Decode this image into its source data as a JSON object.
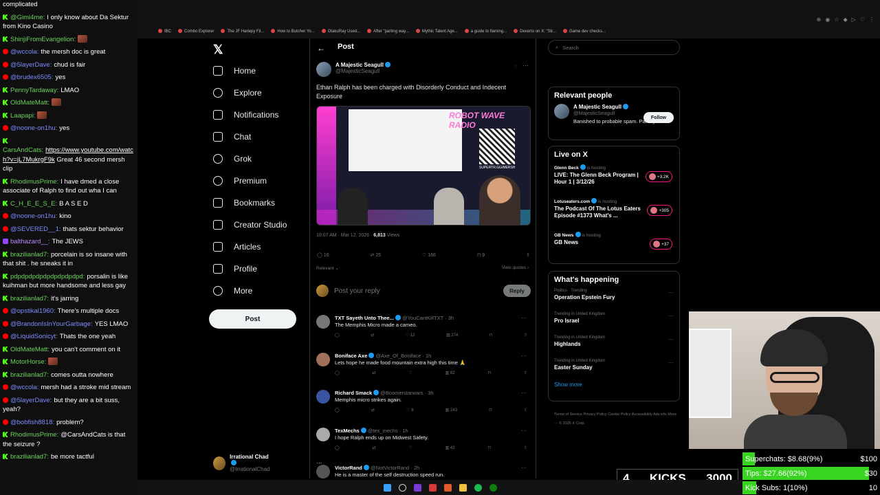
{
  "chat": [
    {
      "platform": "none",
      "user": "",
      "text": "complicated"
    },
    {
      "platform": "kick",
      "user": "@Gimi4me:",
      "text": "I only know about Da Sektur from Kino Casino"
    },
    {
      "platform": "kick",
      "user": "ShinjiFromEvangelion:",
      "text": ""
    },
    {
      "platform": "yt",
      "user": "@wccola:",
      "text": "the mersh doc is great"
    },
    {
      "platform": "yt",
      "user": "@5layerDave:",
      "text": "chud is fair"
    },
    {
      "platform": "yt",
      "user": "@brudex6505:",
      "text": "yes"
    },
    {
      "platform": "kick",
      "user": "PennyTardaway:",
      "text": "LMAO"
    },
    {
      "platform": "kick",
      "user": "OldMateMatt:",
      "text": ""
    },
    {
      "platform": "kick",
      "user": "Laapapi:",
      "text": ""
    },
    {
      "platform": "yt",
      "user": "@noone-on1hu:",
      "text": "yes"
    },
    {
      "platform": "kick",
      "user": "CarsAndCats:",
      "text": "Great 46 second mersh clip",
      "link": "https://www.youtube.com/watch?v=jL7MukrgF9k"
    },
    {
      "platform": "kick",
      "user": "RhodimusPrime:",
      "text": "I have dmed a close associate of Ralph to find out wha I can"
    },
    {
      "platform": "kick",
      "user": "C_H_E_E_S_E:",
      "text": "B A S E D"
    },
    {
      "platform": "yt",
      "user": "@noone-on1hu:",
      "text": "kino"
    },
    {
      "platform": "yt",
      "user": "@SEVERED__1:",
      "text": "thats sektur behavior"
    },
    {
      "platform": "twitch",
      "user": "balthazard__:",
      "text": "The JEWS"
    },
    {
      "platform": "kick",
      "user": "brazilianlad7:",
      "text": "porcelain is so insane with that shit . he sneaks it in"
    },
    {
      "platform": "kick",
      "user": "pdpdpdpdpdpdpdpdpdpd:",
      "text": "porsalin is like kuihman but more handsome and less gay"
    },
    {
      "platform": "kick",
      "user": "brazilianlad7:",
      "text": "it's jarring"
    },
    {
      "platform": "yt",
      "user": "@opstikal1960:",
      "text": "There's multiple docs"
    },
    {
      "platform": "yt",
      "user": "@BrandonIsInYourGarbage:",
      "text": "YES LMAO"
    },
    {
      "platform": "yt",
      "user": "@LiquidSonicyt:",
      "text": "Thats the one yeah"
    },
    {
      "platform": "kick",
      "user": "OldMateMatt:",
      "text": "you can't comment on it"
    },
    {
      "platform": "kick",
      "user": "MotorHorse:",
      "text": ""
    },
    {
      "platform": "kick",
      "user": "brazilianlad7:",
      "text": "comes outta nowhere"
    },
    {
      "platform": "yt",
      "user": "@wccola:",
      "text": "mersh had a stroke mid stream"
    },
    {
      "platform": "yt",
      "user": "@5layerDave:",
      "text": "but they are a bit suss, yeah?"
    },
    {
      "platform": "yt",
      "user": "@bobfish8818:",
      "text": "problem?"
    },
    {
      "platform": "kick",
      "user": "RhodimusPrime:",
      "text": "@CarsAndCats is that the seizure ?"
    },
    {
      "platform": "kick",
      "user": "brazilianlad7:",
      "text": "be more tactful"
    }
  ],
  "bookmarks": [
    "IBC",
    "Combo Explorer",
    "The JF Harlepy Fil...",
    "How to Butcher Yo...",
    "OtakuRay Used...",
    "After \"parting way...",
    "Mythic Talent Age...",
    "a guide to flaming...",
    "Dexerto on X: \"Str...",
    "Game dev checks..."
  ],
  "nav": {
    "logo": "𝕏",
    "items": [
      "Home",
      "Explore",
      "Notifications",
      "Chat",
      "Grok",
      "Premium",
      "Bookmarks",
      "Creator Studio",
      "Articles",
      "Profile",
      "More"
    ],
    "post_button": "Post",
    "account_name": "Irrational Chad",
    "account_handle": "@IrrationalChad",
    "account_more": "···"
  },
  "post": {
    "header": "Post",
    "back": "←",
    "author_name": "A Majestic Seagull",
    "author_handle": "@MajesticSeagull",
    "text": "Ethan Ralph has been charged with Disorderly Conduct and Indecent Exposure",
    "media_title": "ROBOT WAVE RADIO",
    "media_qr_label": "SUPERTR.GG/MERSH",
    "time": "10:07 AM · Mar 12, 2026 · ",
    "views_count": "6,813",
    "views_label": " Views",
    "replies": "16",
    "reposts": "25",
    "likes": "166",
    "bookmarks": "9",
    "relevant": "Relevant ⌄",
    "view_quotes": "View quotes ›",
    "reply_placeholder": "Post your reply",
    "reply_button": "Reply"
  },
  "replies": [
    {
      "name": "TXT Sayeth Unto Thee...",
      "handle": "@YouCantKillTXT · 3h",
      "text": "The Memphis Micro made a cameo.",
      "likes": "12",
      "views": "274",
      "color": "#777"
    },
    {
      "name": "Boniface Axe",
      "handle": "@Axe_Of_Boniface · 1h",
      "text": "Lets hope he made food mountain extra high this time 🙏",
      "likes": "",
      "views": "82",
      "color": "#a0705a"
    },
    {
      "name": "Richard Smack",
      "handle": "@Boomerstarwars · 3h",
      "text": "Memphis micro strikes again.",
      "likes": "6",
      "views": "243",
      "color": "#3a55a0"
    },
    {
      "name": "TexMechs",
      "handle": "@tex_mechs · 1h",
      "text": "I hope Ralph ends up on Midwest Safety.",
      "likes": "",
      "views": "43",
      "color": "#aaa"
    },
    {
      "name": "VictorRand",
      "handle": "@NotVictorRand · 2h",
      "text": "He is a master of the self destruction speed run.",
      "likes": "",
      "views": "",
      "color": "#555"
    }
  ],
  "sidebar": {
    "search_placeholder": "Search",
    "relevant_title": "Relevant people",
    "rel_name": "A Majestic Seagull",
    "rel_handle": "@MajesticSeagull",
    "rel_bio": "Banished to probable spam. Parody?",
    "follow": "Follow",
    "live_title": "Live on X",
    "live": [
      {
        "host": "Glenn Beck",
        "status": "is hosting",
        "title": "LIVE: The Glenn Beck Program | Hour 1 | 3/12/26",
        "count": "+3.2K"
      },
      {
        "host": "Lotuseaters.com",
        "status": "is hosting",
        "title": "The Podcast Of The Lotus Eaters Episode #1373 What's ...",
        "count": "+305"
      },
      {
        "host": "GB News",
        "status": "is hosting",
        "title": "GB News",
        "count": "+37"
      }
    ],
    "happening_title": "What's happening",
    "trends": [
      {
        "context": "Politics · Trending",
        "name": "Operation Epstein Fury"
      },
      {
        "context": "Trending in United Kingdom",
        "name": "Pro Israel"
      },
      {
        "context": "Trending in United Kingdom",
        "name": "Highlands"
      },
      {
        "context": "Trending in United Kingdom",
        "name": "Easter Sunday"
      }
    ],
    "show_more": "Show more",
    "footer": "Terms of Service   Privacy Policy   Cookie Policy   Accessibility   Ads info   More ···   © 2026 X Corp."
  },
  "stream": {
    "kicks_count": "4",
    "kicks_label": "KICKS",
    "kicks_goal": "3000",
    "superchats_label": "Superchats: $8.68(9%)",
    "superchats_goal": "$100",
    "superchats_fraction": 0.09,
    "tips_label": "Tips: $27.66(92%)",
    "tips_goal": "$30",
    "tips_fraction": 0.92,
    "subs_label": "Kick Subs: 1(10%)",
    "subs_goal": "10",
    "subs_fraction": 0.1
  },
  "colors": {
    "x_blue": "#1d9bf0",
    "kick_green": "#53fc18",
    "fund_green": "#39d321"
  }
}
